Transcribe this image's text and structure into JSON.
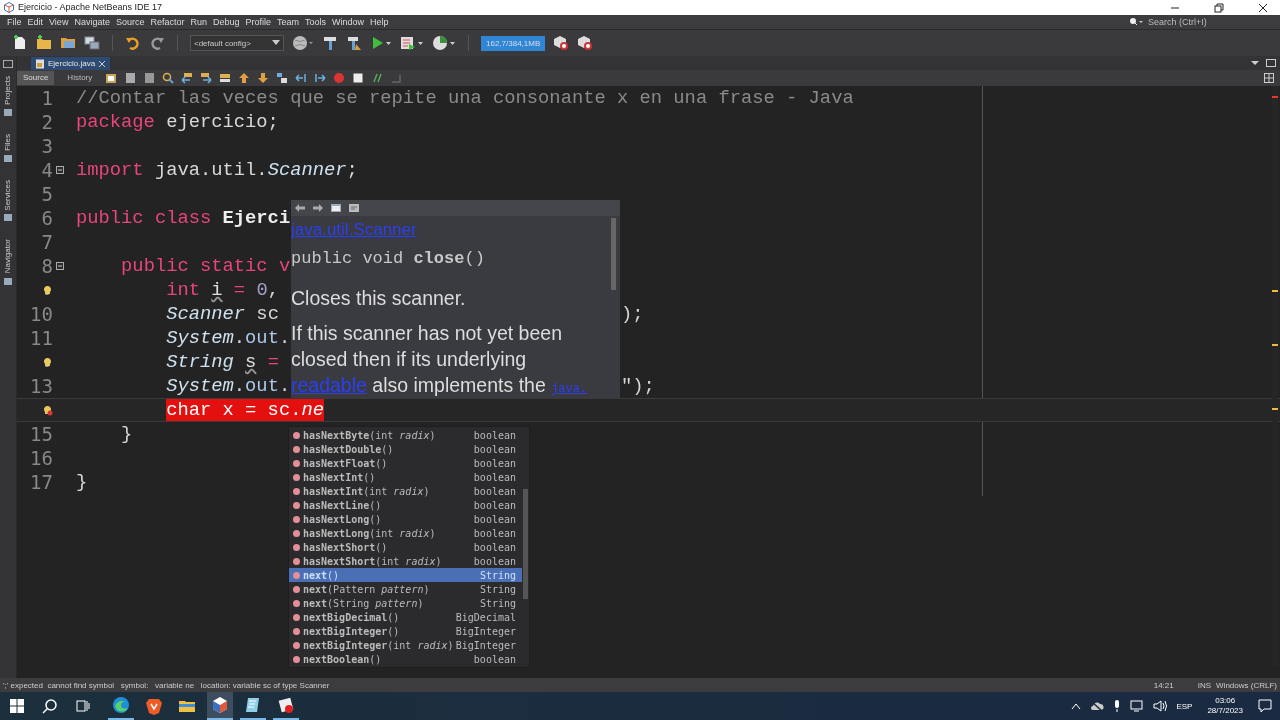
{
  "window": {
    "title": "Ejercicio - Apache NetBeans IDE 17"
  },
  "menu": [
    "File",
    "Edit",
    "View",
    "Navigate",
    "Source",
    "Refactor",
    "Run",
    "Debug",
    "Profile",
    "Team",
    "Tools",
    "Window",
    "Help"
  ],
  "search": {
    "placeholder": "Search (Ctrl+I)"
  },
  "toolbar": {
    "config": "<default config>",
    "memory": "162,7/384,1MB"
  },
  "side_tabs": [
    "Projects",
    "Files",
    "Services",
    "Navigator"
  ],
  "editor_tabs": [
    {
      "label": "Ejercicio.java",
      "selected": true
    }
  ],
  "view_tabs": [
    {
      "label": "Source",
      "selected": true
    },
    {
      "label": "History",
      "selected": false
    }
  ],
  "code_lines": [
    {
      "number": "1",
      "tokens": [
        {
          "t": "//Contar las veces que se repite una consonante x en una frase - Java",
          "kind": "comment"
        }
      ]
    },
    {
      "number": "2",
      "tokens": [
        {
          "t": "package ",
          "kind": "kw"
        },
        {
          "t": "ejercicio;",
          "kind": "plain"
        }
      ]
    },
    {
      "number": "3"
    },
    {
      "number": "4",
      "fold": true,
      "tokens": [
        {
          "t": "import ",
          "kind": "kw"
        },
        {
          "t": "java.util.",
          "kind": "plain"
        },
        {
          "t": "Scanner",
          "kind": "type"
        },
        {
          "t": ";",
          "kind": "plain"
        }
      ]
    },
    {
      "number": "5"
    },
    {
      "number": "6",
      "tokens": [
        {
          "t": "public class ",
          "kind": "kw"
        },
        {
          "t": "Ejerci",
          "kind": "bold"
        }
      ]
    },
    {
      "number": "7"
    },
    {
      "number": "8",
      "fold": true,
      "kind": "member",
      "tokens": [
        {
          "t": "public static v",
          "kind": "kw"
        }
      ]
    },
    {
      "hint": true,
      "kind": "statement",
      "tokens": [
        {
          "t": "int ",
          "kind": "kw"
        },
        {
          "t": "i",
          "kind": "warn"
        },
        {
          "t": " = ",
          "kind": "kw"
        },
        {
          "t": "0",
          "kind": "num"
        },
        {
          "t": ",",
          "kind": "plain"
        }
      ]
    },
    {
      "number": "10",
      "kind": "statement",
      "tail": ");",
      "tokens": [
        {
          "t": "Scanner",
          "kind": "type"
        },
        {
          "t": " sc",
          "kind": "plain"
        }
      ]
    },
    {
      "number": "11",
      "kind": "statement",
      "tokens": [
        {
          "t": "System",
          "kind": "type"
        },
        {
          "t": ".",
          "kind": "plain"
        },
        {
          "t": "out",
          "kind": "field"
        },
        {
          "t": ".",
          "kind": "plain"
        }
      ]
    },
    {
      "hint": true,
      "kind": "statement",
      "tokens": [
        {
          "t": "String ",
          "kind": "type"
        },
        {
          "t": "s",
          "kind": "warn"
        },
        {
          "t": " =",
          "kind": "kw"
        }
      ]
    },
    {
      "number": "13",
      "kind": "statement",
      "tail": "\");",
      "tokens": [
        {
          "t": "System",
          "kind": "type"
        },
        {
          "t": ".",
          "kind": "plain"
        },
        {
          "t": "out",
          "kind": "field"
        },
        {
          "t": ".",
          "kind": "plain"
        }
      ]
    },
    {
      "error_hint": true,
      "current": true,
      "kind": "statement",
      "tokens": [
        {
          "t": "char x = sc.",
          "kind": "plain",
          "error": true
        },
        {
          "t": "ne",
          "kind": "type",
          "error": true
        }
      ]
    },
    {
      "number": "15",
      "kind": "member",
      "tokens": [
        {
          "t": "}",
          "kind": "plain"
        }
      ]
    },
    {
      "number": "16"
    },
    {
      "number": "17",
      "tokens": [
        {
          "t": "}",
          "kind": "plain"
        }
      ]
    }
  ],
  "javadoc": {
    "class_link": "java.util.Scanner",
    "signature": "public void **close**()",
    "summary": "Closes this scanner.",
    "body": [
      {
        "text": "If this scanner has not yet been closed then if its underlying "
      },
      {
        "text": "readable",
        "kind": "link"
      },
      {
        "text": " also implements the "
      },
      {
        "text": "java.",
        "kind": "code_link"
      }
    ]
  },
  "completion": {
    "items": [
      {
        "signature": "**hasNextByte**(int *radix*)",
        "returns": "boolean",
        "selected": false
      },
      {
        "signature": "**hasNextDouble**()",
        "returns": "boolean",
        "selected": false
      },
      {
        "signature": "**hasNextFloat**()",
        "returns": "boolean",
        "selected": false
      },
      {
        "signature": "**hasNextInt**()",
        "returns": "boolean",
        "selected": false
      },
      {
        "signature": "**hasNextInt**(int *radix*)",
        "returns": "boolean",
        "selected": false
      },
      {
        "signature": "**hasNextLine**()",
        "returns": "boolean",
        "selected": false
      },
      {
        "signature": "**hasNextLong**()",
        "returns": "boolean",
        "selected": false
      },
      {
        "signature": "**hasNextLong**(int *radix*)",
        "returns": "boolean",
        "selected": false
      },
      {
        "signature": "**hasNextShort**()",
        "returns": "boolean",
        "selected": false
      },
      {
        "signature": "**hasNextShort**(int *radix*)",
        "returns": "boolean",
        "selected": false
      },
      {
        "signature": "**next**()",
        "returns": "String",
        "selected": true
      },
      {
        "signature": "**next**(Pattern *pattern*)",
        "returns": "String",
        "selected": false
      },
      {
        "signature": "**next**(String *pattern*)",
        "returns": "String",
        "selected": false
      },
      {
        "signature": "**nextBigDecimal**()",
        "returns": "BigDecimal",
        "selected": false
      },
      {
        "signature": "**nextBigInteger**()",
        "returns": "BigInteger",
        "selected": false
      },
      {
        "signature": "**nextBigInteger**(int *radix*)",
        "returns": "BigInteger",
        "selected": false
      },
      {
        "signature": "**nextBoolean**()",
        "returns": "boolean",
        "selected": false
      }
    ]
  },
  "status_bar": {
    "message": "';' expected  cannot find symbol   symbol:   variable ne   location: variable sc of type Scanner",
    "position": "14:21",
    "mode": "INS",
    "line_ending": "Windows (CRLF)"
  },
  "taskbar": {
    "apps": [
      {
        "kind": "edge",
        "running": true,
        "active": false
      },
      {
        "kind": "brave",
        "running": false,
        "active": false
      },
      {
        "kind": "folder",
        "running": false,
        "active": false
      },
      {
        "kind": "netbeans",
        "running": true,
        "active": true
      },
      {
        "kind": "notepad",
        "running": true,
        "active": false
      },
      {
        "kind": "paint",
        "running": true,
        "active": false
      }
    ],
    "language": "ESP",
    "time": "03:06",
    "date": "28/7/2023"
  }
}
